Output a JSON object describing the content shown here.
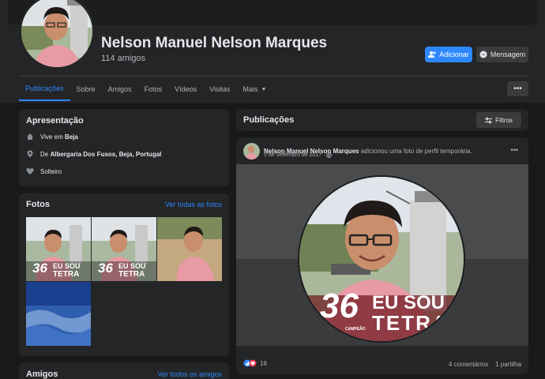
{
  "profile": {
    "name": "Nelson Manuel Nelson Marques",
    "friends": "114 amigos",
    "add_label": "Adicionar",
    "message_label": "Mensagem"
  },
  "tabs": [
    {
      "label": "Publicações",
      "active": true
    },
    {
      "label": "Sobre"
    },
    {
      "label": "Amigos"
    },
    {
      "label": "Fotos"
    },
    {
      "label": "Vídeos"
    },
    {
      "label": "Visitas"
    },
    {
      "label": "Mais"
    }
  ],
  "more_button": "•••",
  "intro": {
    "title": "Apresentação",
    "lives_prefix": "Vive em ",
    "lives_place": "Beja",
    "from_prefix": "De ",
    "from_place": "Albergaria Dos Fusos, Beja, Portugal",
    "status": "Solteiro"
  },
  "photos": {
    "title": "Fotos",
    "see_all": "Ver todas as fotos",
    "overlay_number": "36",
    "overlay_line1": "EU SOU",
    "overlay_line2": "TETRA"
  },
  "friends_card": {
    "title": "Amigos",
    "see_all": "Ver todos os amigos"
  },
  "posts": {
    "title": "Publicações",
    "filters_label": "Filtros",
    "author": "Nelson Manuel Nelson Marques",
    "action": " adicionou uma foto de perfil temporária.",
    "date": "5 de Setembro de 2017 · ",
    "menu": "•••",
    "overlay_number": "36",
    "overlay_small": "CAMPEÃO",
    "overlay_line1": "EU SOU",
    "overlay_line2": "TETRA",
    "reactions_count": "16",
    "comments": "4 comentários",
    "shares": "1 partilha"
  },
  "colors": {
    "accent": "#2d88ff",
    "love": "#f33e58",
    "background": "#18191a",
    "card": "#242526"
  }
}
